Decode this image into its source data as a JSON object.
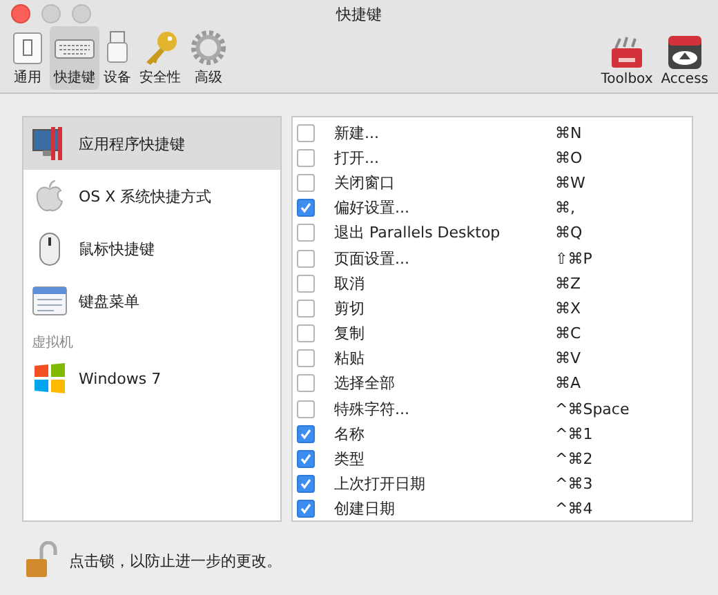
{
  "window": {
    "title": "快捷键"
  },
  "toolbar": {
    "items": [
      {
        "label": "通用",
        "selected": false
      },
      {
        "label": "快捷键",
        "selected": true
      },
      {
        "label": "设备",
        "selected": false
      },
      {
        "label": "安全性",
        "selected": false
      },
      {
        "label": "高级",
        "selected": false
      }
    ],
    "right_items": [
      {
        "label": "Toolbox"
      },
      {
        "label": "Access"
      }
    ]
  },
  "sidebar": {
    "items": [
      {
        "kind": "item",
        "label": "应用程序快捷键",
        "selected": true
      },
      {
        "kind": "item",
        "label": "OS X 系统快捷方式",
        "selected": false
      },
      {
        "kind": "item",
        "label": "鼠标快捷键",
        "selected": false
      },
      {
        "kind": "item",
        "label": "键盘菜单",
        "selected": false
      },
      {
        "kind": "header",
        "label": "虚拟机"
      },
      {
        "kind": "item",
        "label": "Windows 7",
        "selected": false
      }
    ]
  },
  "shortcuts": [
    {
      "name": "新建...",
      "keys": "⌘N",
      "checked": false
    },
    {
      "name": "打开...",
      "keys": "⌘O",
      "checked": false
    },
    {
      "name": "关闭窗口",
      "keys": "⌘W",
      "checked": false
    },
    {
      "name": "偏好设置...",
      "keys": "⌘,",
      "checked": true
    },
    {
      "name": "退出 Parallels Desktop",
      "keys": "⌘Q",
      "checked": false
    },
    {
      "name": "页面设置...",
      "keys": "⇧⌘P",
      "checked": false
    },
    {
      "name": "取消",
      "keys": "⌘Z",
      "checked": false
    },
    {
      "name": "剪切",
      "keys": "⌘X",
      "checked": false
    },
    {
      "name": "复制",
      "keys": "⌘C",
      "checked": false
    },
    {
      "name": "粘贴",
      "keys": "⌘V",
      "checked": false
    },
    {
      "name": "选择全部",
      "keys": "⌘A",
      "checked": false
    },
    {
      "name": "特殊字符...",
      "keys": "^⌘Space",
      "checked": false
    },
    {
      "name": "名称",
      "keys": "^⌘1",
      "checked": true
    },
    {
      "name": "类型",
      "keys": "^⌘2",
      "checked": true
    },
    {
      "name": "上次打开日期",
      "keys": "^⌘3",
      "checked": true
    },
    {
      "name": "创建日期",
      "keys": "^⌘4",
      "checked": true
    }
  ],
  "footer": {
    "lock_text": "点击锁，以防止进一步的更改。"
  }
}
